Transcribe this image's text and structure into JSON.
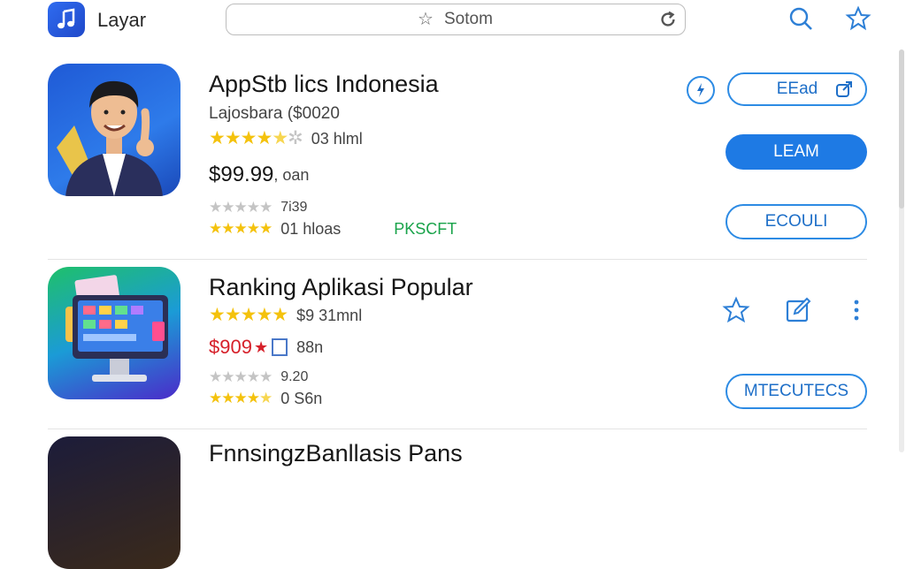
{
  "header": {
    "app_name": "Layar",
    "search_text": "Sotom",
    "icons": [
      "music-icon",
      "star-icon",
      "refresh-icon",
      "search-icon",
      "favorite-icon"
    ]
  },
  "apps": [
    {
      "title": "AppStb lics Indonesia",
      "subtitle": "Lajosbara ($0020",
      "rating_count": "03 hlml",
      "price": "$99.99",
      "price_suffix": ", oan",
      "score": "7i39",
      "downloads": "01 hloas",
      "publisher": "PKSCFT",
      "buttons": {
        "read": "EEad",
        "learn": "LEAM",
        "ecouli": "ECOULI"
      }
    },
    {
      "title": "Ranking Aplikasi Popular",
      "rating_count": "$9 31mnl",
      "price": "$909",
      "price_suffix": "88n",
      "score": "9.20",
      "downloads": "0 S6n",
      "buttons": {
        "more": "MTECUTECS"
      }
    },
    {
      "title": "FnnsingzBanllasis Pans"
    }
  ],
  "colors": {
    "accent": "#1e7ae4",
    "star": "#f4c20d",
    "publisher": "#19a34a",
    "sale": "#d6202a"
  }
}
